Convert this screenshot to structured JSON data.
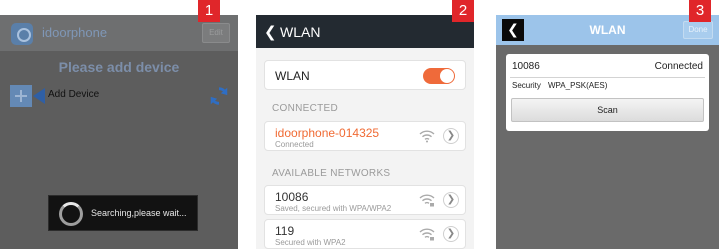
{
  "badges": [
    "1",
    "2",
    "3"
  ],
  "screen1": {
    "app_title": "idoorphone",
    "edit_label": "Edit",
    "empty_title": "Please add device",
    "add_device_label": "Add Device",
    "toast_text": "Searching,please wait..."
  },
  "screen2": {
    "title": "WLAN",
    "wlan_label": "WLAN",
    "wlan_on": true,
    "connected_header": "CONNECTED",
    "connected": {
      "name": "idoorphone-014325",
      "status": "Connected"
    },
    "available_header": "AVAILABLE NETWORKS",
    "networks": [
      {
        "name": "10086",
        "status": "Saved, secured with WPA/WPA2"
      },
      {
        "name": "119",
        "status": "Secured with WPA2"
      }
    ]
  },
  "screen3": {
    "title": "WLAN",
    "done_label": "Done",
    "ssid": "10086",
    "status": "Connected",
    "security_label": "Security",
    "security_value": "WPA_PSK(AES)",
    "scan_label": "Scan"
  },
  "colors": {
    "accent_orange": "#f06a33",
    "badge_red": "#e0262a",
    "screen3_header": "#9cc4ea"
  }
}
